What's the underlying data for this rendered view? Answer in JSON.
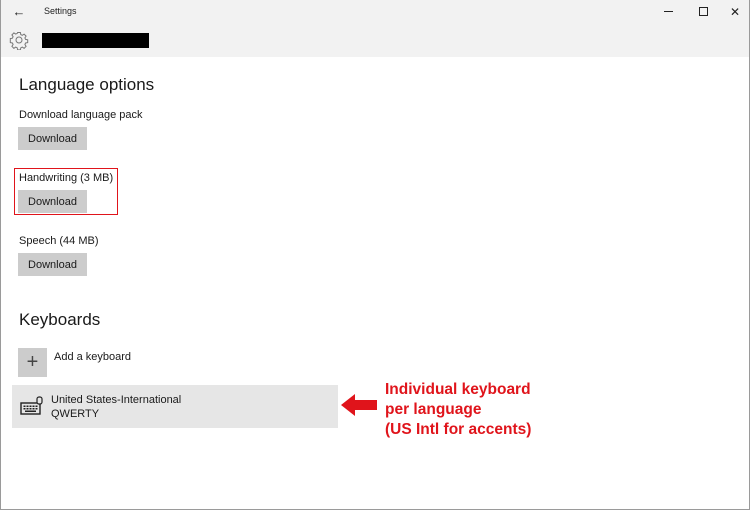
{
  "window": {
    "title": "Settings",
    "back_icon": "back-arrow-icon",
    "minimize_icon": "minimize-icon",
    "maximize_icon": "maximize-icon",
    "close_icon": "close-icon"
  },
  "header": {
    "icon": "gear-icon",
    "page_name_redacted": true
  },
  "language_options": {
    "title": "Language options",
    "items": [
      {
        "label": "Download language pack",
        "button": "Download"
      },
      {
        "label": "Handwriting (3 MB)",
        "button": "Download",
        "highlighted": true
      },
      {
        "label": "Speech (44 MB)",
        "button": "Download"
      }
    ]
  },
  "keyboards": {
    "title": "Keyboards",
    "add_label": "Add a keyboard",
    "add_icon": "plus-icon",
    "list": [
      {
        "name": "United States-International",
        "layout": "QWERTY",
        "icon": "keyboard-icon"
      }
    ]
  },
  "annotation": {
    "lines": [
      "Individual keyboard",
      "per language",
      "(US Intl for accents)"
    ],
    "color": "#e0141b"
  }
}
